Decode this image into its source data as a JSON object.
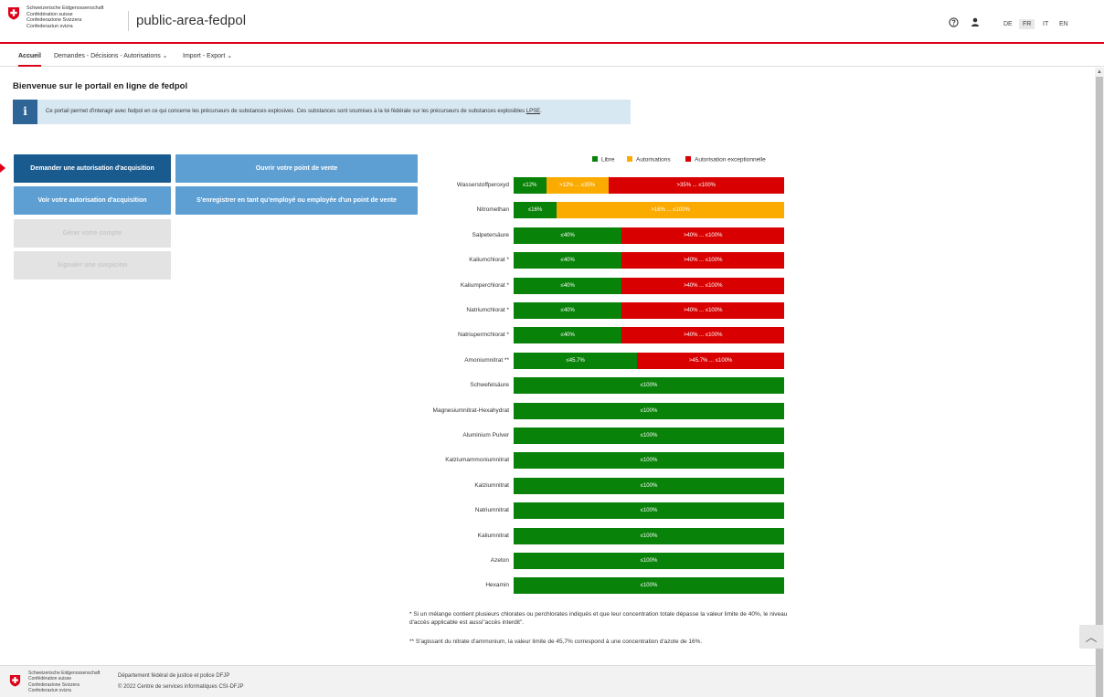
{
  "header": {
    "logo_text": "Schweizerische Eidgenossenschaft\nConfédération suisse\nConfederazione Svizzera\nConfederaziun svizra",
    "app_title": "public-area-fedpol",
    "help_icon": "help-circle-icon",
    "user_icon": "user-icon",
    "languages": [
      "DE",
      "FR",
      "IT",
      "EN"
    ],
    "active_language": "FR"
  },
  "nav": {
    "home": "Accueil",
    "requests": "Demandes - Décisions - Autorisations ⌄",
    "import_export": "Import - Export ⌄"
  },
  "page": {
    "title": "Bienvenue sur le portail en ligne de fedpol",
    "info_icon": "i",
    "info_text": "Ce portail permet d'interagir avec fedpol en ce qui concerne les précurseurs de substances explosives. Ces substances sont soumises à la loi fédérale sur les précurseurs de substances explosibles ",
    "info_link": "LPSE",
    "info_end": "."
  },
  "buttons": {
    "request_acquisition": "Demander une autorisation d'acquisition",
    "open_sale_point": "Ouvrir votre point de vente",
    "view_acquisition": "Voir votre autorisation d'acquisition",
    "register_employee": "S'enregistrer en tant qu'employé ou employée d'un point de vente",
    "manage_account": "Gérer votre compte",
    "report_suspicion": "Signaler une suspicion"
  },
  "legend": {
    "free": "Libre",
    "authorisations": "Autorisations",
    "exceptional": "Autorisation exceptionnelle"
  },
  "colors": {
    "green": "#088208",
    "orange": "#fbaa00",
    "red": "#d80000",
    "swiss_red": "#dc0018",
    "primary_blue": "#1a5b8f",
    "light_blue": "#5e9fd3"
  },
  "chart_data": {
    "type": "bar",
    "orientation": "horizontal-stacked",
    "xlim": [
      0,
      100
    ],
    "unit": "% concentration",
    "rows": [
      {
        "name": "Wasserstoffperoxyd",
        "segments": [
          {
            "level": "free",
            "from": 0,
            "to": 12,
            "label": "≤12%"
          },
          {
            "level": "authorisation",
            "from": 12,
            "to": 35,
            "label": ">12% ... ≤35%"
          },
          {
            "level": "exceptional",
            "from": 35,
            "to": 100,
            "label": ">35% ... ≤100%"
          }
        ]
      },
      {
        "name": "Nitromethan",
        "segments": [
          {
            "level": "free",
            "from": 0,
            "to": 16,
            "label": "≤16%"
          },
          {
            "level": "authorisation",
            "from": 16,
            "to": 100,
            "label": ">16% ... ≤100%"
          }
        ]
      },
      {
        "name": "Salpetersäure",
        "segments": [
          {
            "level": "free",
            "from": 0,
            "to": 40,
            "label": "≤40%"
          },
          {
            "level": "exceptional",
            "from": 40,
            "to": 100,
            "label": ">40% ... ≤100%"
          }
        ]
      },
      {
        "name": "Kaliumchlorat *",
        "segments": [
          {
            "level": "free",
            "from": 0,
            "to": 40,
            "label": "≤40%"
          },
          {
            "level": "exceptional",
            "from": 40,
            "to": 100,
            "label": ">40% ... ≤100%"
          }
        ]
      },
      {
        "name": "Kaliumperchlorat *",
        "segments": [
          {
            "level": "free",
            "from": 0,
            "to": 40,
            "label": "≤40%"
          },
          {
            "level": "exceptional",
            "from": 40,
            "to": 100,
            "label": ">40% ... ≤100%"
          }
        ]
      },
      {
        "name": "Natriumchlorat *",
        "segments": [
          {
            "level": "free",
            "from": 0,
            "to": 40,
            "label": "≤40%"
          },
          {
            "level": "exceptional",
            "from": 40,
            "to": 100,
            "label": ">40% ... ≤100%"
          }
        ]
      },
      {
        "name": "Natriupermchlorat *",
        "segments": [
          {
            "level": "free",
            "from": 0,
            "to": 40,
            "label": "≤40%"
          },
          {
            "level": "exceptional",
            "from": 40,
            "to": 100,
            "label": ">40% ... ≤100%"
          }
        ]
      },
      {
        "name": "Amoniumnitrat **",
        "segments": [
          {
            "level": "free",
            "from": 0,
            "to": 45.7,
            "label": "≤45.7%"
          },
          {
            "level": "exceptional",
            "from": 45.7,
            "to": 100,
            "label": ">45.7% ... ≤100%"
          }
        ]
      },
      {
        "name": "Schwefelsäure",
        "segments": [
          {
            "level": "free",
            "from": 0,
            "to": 100,
            "label": "≤100%"
          }
        ]
      },
      {
        "name": "Magnesiumnitrat-Hexahydrat",
        "segments": [
          {
            "level": "free",
            "from": 0,
            "to": 100,
            "label": "≤100%"
          }
        ]
      },
      {
        "name": "Aluminium Pulver",
        "segments": [
          {
            "level": "free",
            "from": 0,
            "to": 100,
            "label": "≤100%"
          }
        ]
      },
      {
        "name": "Kalziumammoniumnitrat",
        "segments": [
          {
            "level": "free",
            "from": 0,
            "to": 100,
            "label": "≤100%"
          }
        ]
      },
      {
        "name": "Kalziumnitrat",
        "segments": [
          {
            "level": "free",
            "from": 0,
            "to": 100,
            "label": "≤100%"
          }
        ]
      },
      {
        "name": "Natriumnitrat",
        "segments": [
          {
            "level": "free",
            "from": 0,
            "to": 100,
            "label": "≤100%"
          }
        ]
      },
      {
        "name": "Kaliumnitrat",
        "segments": [
          {
            "level": "free",
            "from": 0,
            "to": 100,
            "label": "≤100%"
          }
        ]
      },
      {
        "name": "Azeton",
        "segments": [
          {
            "level": "free",
            "from": 0,
            "to": 100,
            "label": "≤100%"
          }
        ]
      },
      {
        "name": "Hexamin",
        "segments": [
          {
            "level": "free",
            "from": 0,
            "to": 100,
            "label": "≤100%"
          }
        ]
      }
    ],
    "legend": [
      "Libre",
      "Autorisations",
      "Autorisation exceptionnelle"
    ],
    "legend_position": "top-right"
  },
  "notes": {
    "note1": "* Si un mélange contient plusieurs chlorates ou perchlorates indiqués et que leur concentration totale dépasse la valeur limite de 40%, le niveau d'accès applicable est aussi\"accès interdit\".",
    "note2": "** S'agissant du nitrate d'ammonium, la valeur limite de 45,7% correspond à une concentration d'azote de 16%."
  },
  "footer": {
    "logo_text": "Schweizerische Eidgenossenschaft\nConfédération suisse\nConfederazione Svizzera\nConfederaziun svizra",
    "department": "Département fédéral de justice et police DFJP",
    "copyright": "© 2022 Centre de services informatiques CSI-DFJP"
  },
  "scroll_to_top_icon": "chevron-up-icon"
}
